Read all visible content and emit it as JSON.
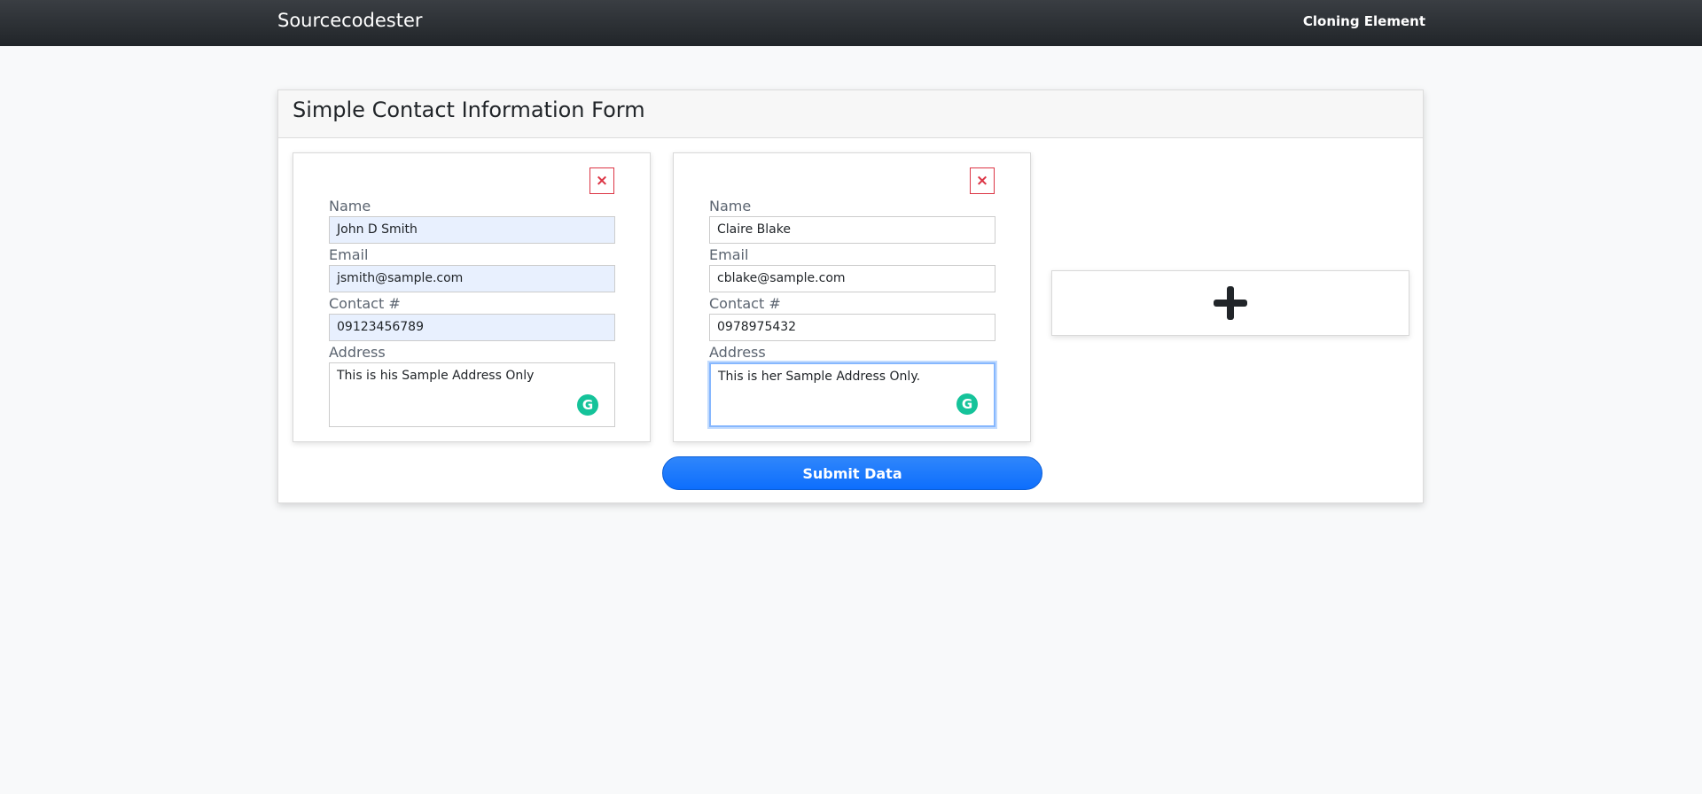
{
  "navbar": {
    "brand": "Sourcecodester",
    "right_link": "Cloning Element"
  },
  "form": {
    "title": "Simple Contact Information Form",
    "labels": {
      "name": "Name",
      "email": "Email",
      "contact": "Contact #",
      "address": "Address"
    },
    "remove_symbol": "×",
    "contacts": [
      {
        "name": "John D Smith",
        "email": "jsmith@sample.com",
        "contact": "09123456789",
        "address": "This is his Sample Address Only"
      },
      {
        "name": "Claire Blake",
        "email": "cblake@sample.com",
        "contact": "0978975432",
        "address": "This is her Sample Address Only."
      }
    ],
    "submit_label": "Submit Data",
    "grammarly_glyph": "G"
  },
  "icons": {
    "remove": "close-icon",
    "add": "plus-icon",
    "grammarly": "grammarly-icon"
  },
  "colors": {
    "navbar": "#212529",
    "remove_button": "#dc3545",
    "submit_button": "#0d6efd",
    "autofill_background": "#e8f0fe",
    "grammarly": "#15c39a"
  }
}
